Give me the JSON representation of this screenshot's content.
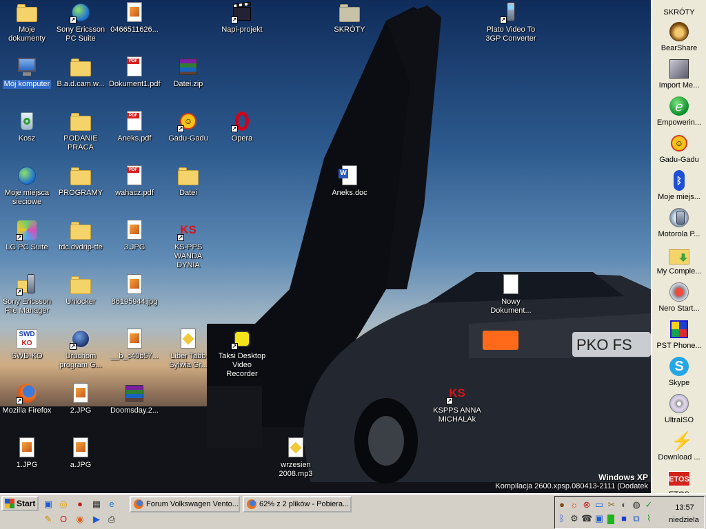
{
  "desktop": {
    "icons": [
      {
        "id": "moje-dokumenty",
        "label": "Moje\ndokumenty"
      },
      {
        "id": "sony-ericsson-pc-suite",
        "label": "Sony Ericsson\nPC Suite"
      },
      {
        "id": "file-0466511626",
        "label": "0466511626..."
      },
      {
        "id": "napi-projekt",
        "label": "Napi-projekt"
      },
      {
        "id": "skroty-folder",
        "label": "SKRÓTY"
      },
      {
        "id": "plato-video",
        "label": "Plato Video To\n3GP Converter"
      },
      {
        "id": "moj-komputer",
        "label": "Mój komputer"
      },
      {
        "id": "bad-cam",
        "label": "B.a.d.cam.w..."
      },
      {
        "id": "dokument1-pdf",
        "label": "Dokument1.pdf"
      },
      {
        "id": "datei-zip",
        "label": "Datei.zip"
      },
      {
        "id": "kosz",
        "label": "Kosz"
      },
      {
        "id": "podanie-praca",
        "label": "PODANIE\nPRACA"
      },
      {
        "id": "aneks-pdf",
        "label": "Aneks.pdf"
      },
      {
        "id": "gadu-gadu",
        "label": "Gadu-Gadu"
      },
      {
        "id": "opera",
        "label": "Opera"
      },
      {
        "id": "moje-miejsca-sieciowe",
        "label": "Moje miejsca\nsieciowe"
      },
      {
        "id": "programy",
        "label": "PROGRAMY"
      },
      {
        "id": "wahacz-pdf",
        "label": "wahacz.pdf"
      },
      {
        "id": "datei-folder",
        "label": "Datei"
      },
      {
        "id": "aneks-doc",
        "label": "Aneks.doc"
      },
      {
        "id": "lg-pc-suite",
        "label": "LG PC Suite"
      },
      {
        "id": "tdc-dvdrip",
        "label": "tdc.dvdrip-tfe"
      },
      {
        "id": "file-3-jpg",
        "label": "3.JPG"
      },
      {
        "id": "ks-pps-wanda",
        "label": "KS-PPS\nWANDA DYNIA"
      },
      {
        "id": "sony-ericsson-file-manager",
        "label": "Sony Ericsson\nFile Manager"
      },
      {
        "id": "unlocker",
        "label": "Unlocker"
      },
      {
        "id": "file-86195944",
        "label": "86195944.jpg"
      },
      {
        "id": "nowy-dokument",
        "label": "Nowy\nDokument..."
      },
      {
        "id": "swd-ko",
        "label": "SWD-KO"
      },
      {
        "id": "uruchom-program",
        "label": "Uruchom\nprogram G..."
      },
      {
        "id": "file-b-c40b57",
        "label": "__b_c40b57..."
      },
      {
        "id": "liber-tabb",
        "label": "Liber Tabb\nSylwia Gr..."
      },
      {
        "id": "taksi-desktop",
        "label": "Taksi Desktop\nVideo Recorder"
      },
      {
        "id": "mozilla-firefox",
        "label": "Mozilla Firefox"
      },
      {
        "id": "file-2-jpg",
        "label": "2.JPG"
      },
      {
        "id": "doomsday",
        "label": "Doomsday.2..."
      },
      {
        "id": "kspps-anna",
        "label": "KSPPS ANNA\nMICHALAk"
      },
      {
        "id": "file-1-jpg",
        "label": "1.JPG"
      },
      {
        "id": "file-a-jpg",
        "label": "a.JPG"
      },
      {
        "id": "wrzesien-mp3",
        "label": "wrzesien\n2008.mp3"
      }
    ],
    "watermark": {
      "title": "Windows XP",
      "build": "Kompilacja 2600.xpsp.080413-2111 (Dodatek"
    }
  },
  "sidebar": {
    "title": "SKRÓTY",
    "items": [
      {
        "label": "BearShare"
      },
      {
        "label": "Import Me..."
      },
      {
        "label": "Empowerin..."
      },
      {
        "label": "Gadu-Gadu"
      },
      {
        "label": "Moje miejs..."
      },
      {
        "label": "Motorola P..."
      },
      {
        "label": "My Comple..."
      },
      {
        "label": "Nero Start..."
      },
      {
        "label": "PST Phone..."
      },
      {
        "label": "Skype"
      },
      {
        "label": "UltraISO"
      },
      {
        "label": "Download ..."
      },
      {
        "label": "ETOS",
        "icon_text": "ETOS"
      }
    ]
  },
  "taskbar": {
    "start_label": "Start",
    "tasks": [
      {
        "label": "Forum Volkswagen Vento..."
      },
      {
        "label": "62% z 2 plików - Pobiera..."
      }
    ],
    "clock": {
      "time": "13:57",
      "day": "niedziela"
    }
  }
}
